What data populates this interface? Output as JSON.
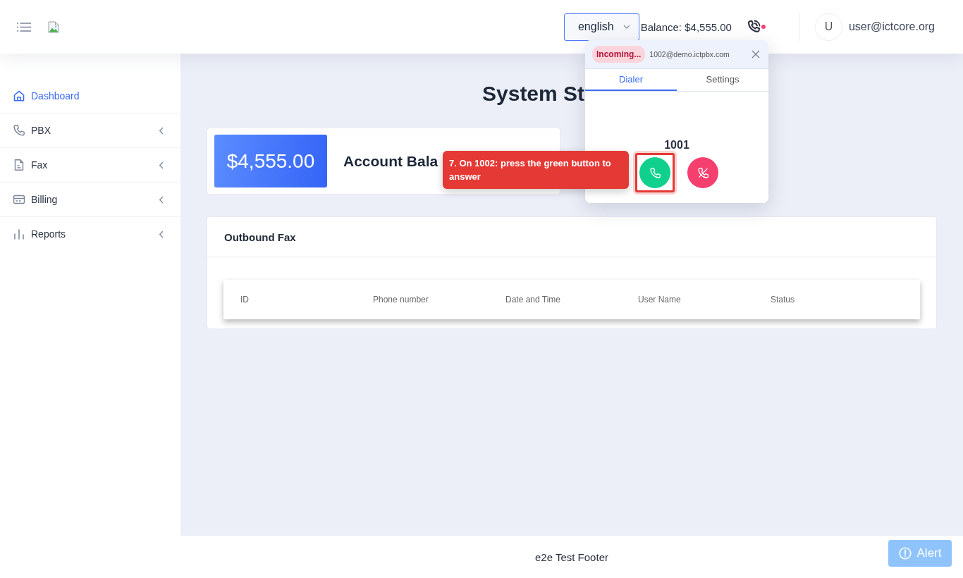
{
  "header": {
    "language": {
      "value": "english"
    },
    "balance": "Balance: $4,555.00",
    "softphone": {
      "ringing": true
    },
    "user": {
      "initial": "U",
      "email": "user@ictcore.org"
    }
  },
  "sidebar": {
    "items": [
      {
        "label": "Dashboard",
        "kind": "link",
        "selected": true
      },
      {
        "label": "PBX",
        "kind": "group",
        "selected": false,
        "expanded": false
      },
      {
        "label": "Fax",
        "kind": "group",
        "selected": false,
        "expanded": false
      },
      {
        "label": "Billing",
        "kind": "group",
        "selected": false,
        "expanded": false
      },
      {
        "label": "Reports",
        "kind": "group",
        "selected": false,
        "expanded": false
      }
    ]
  },
  "page_title": "System St",
  "account_card": {
    "amount": "$4,555.00",
    "label": "Account Bala"
  },
  "fax_card": {
    "title": "Outbound Fax",
    "table": {
      "columns": [
        "ID",
        "Phone number",
        "Date and Time",
        "User Name",
        "Status"
      ]
    }
  },
  "footer": {
    "text": "e2e Test Footer"
  },
  "alert_button": {
    "label": "Alert"
  },
  "dialer": {
    "status": "Incoming...",
    "account": "1002@demo.ictpbx.com",
    "tabs": [
      {
        "label": "Dialer",
        "selected": true
      },
      {
        "label": "Settings",
        "selected": false
      }
    ],
    "caller": "1001",
    "answer_button": {
      "highlighted": true
    }
  },
  "tutorial_tip": {
    "text": "7. On 1002: press the green button to answer"
  }
}
